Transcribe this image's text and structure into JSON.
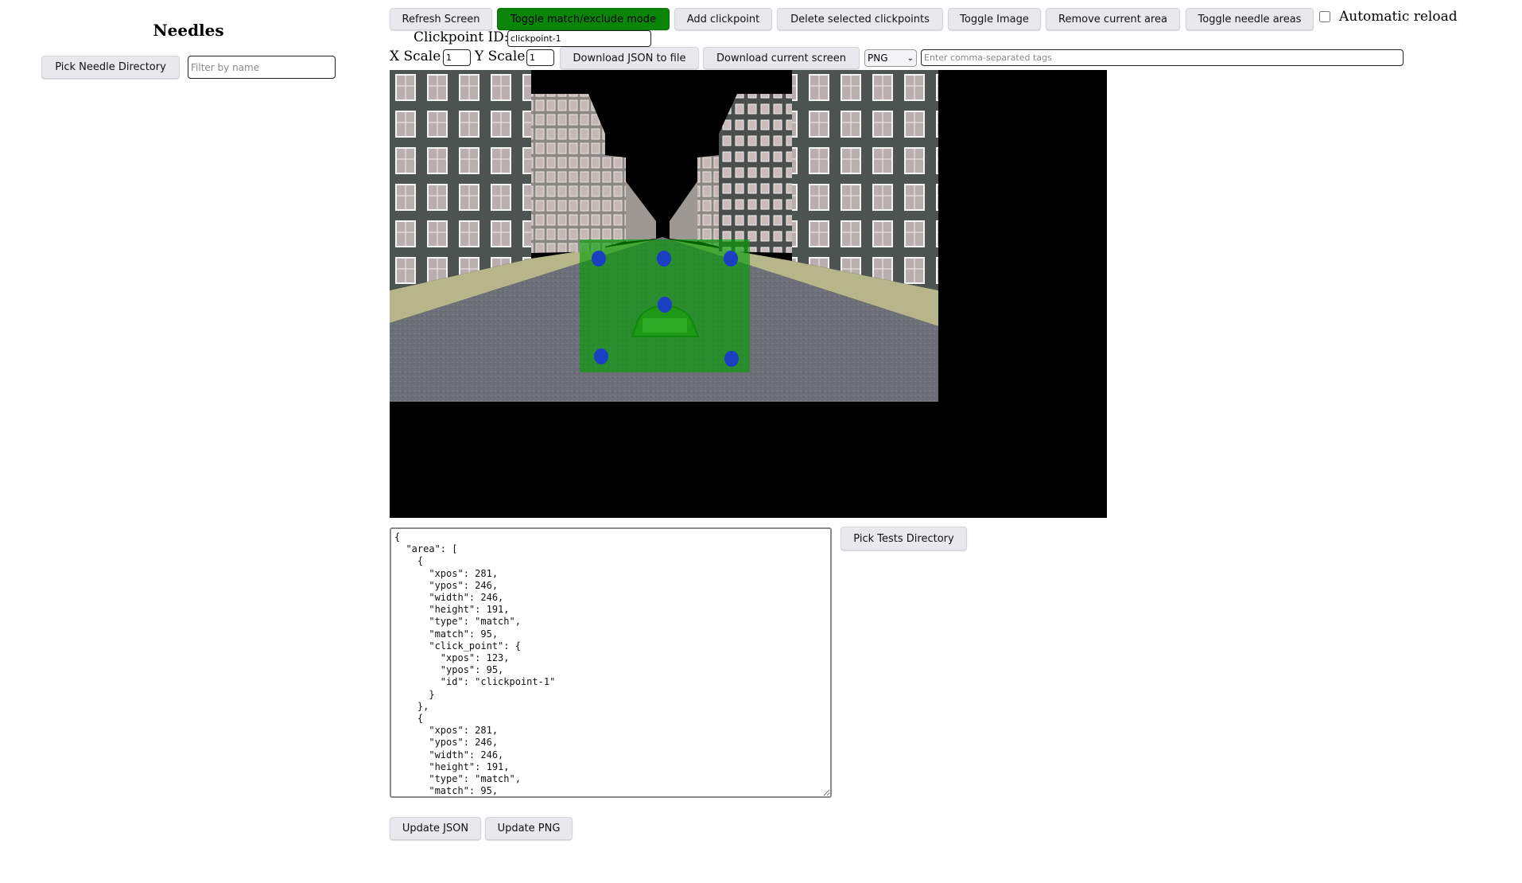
{
  "sidebar": {
    "title": "Needles",
    "pick_dir_label": "Pick Needle Directory",
    "filter_placeholder": "Filter by name"
  },
  "toolbar": {
    "buttons": [
      {
        "label": "Refresh Screen"
      },
      {
        "label": "Toggle match/exclude mode",
        "active": true,
        "color": "#0a850a"
      },
      {
        "label": "Add clickpoint"
      },
      {
        "label": "Delete selected clickpoints"
      },
      {
        "label": "Toggle Image"
      },
      {
        "label": "Remove current area"
      },
      {
        "label": "Toggle needle areas"
      }
    ],
    "auto_reload_label": "Automatic reload",
    "auto_reload_checked": false,
    "clickpoint_label": "Clickpoint ID:",
    "clickpoint_value": "clickpoint-1",
    "xscale_label": "X Scale",
    "xscale_value": "1",
    "yscale_label": "Y Scale",
    "yscale_value": "1",
    "download_json_label": "Download JSON to file",
    "download_screen_label": "Download current screen",
    "format_value": "PNG",
    "tags_placeholder": "Enter comma-separated tags"
  },
  "editor": {
    "json_text": "{\n  \"area\": [\n    {\n      \"xpos\": 281,\n      \"ypos\": 246,\n      \"width\": 246,\n      \"height\": 191,\n      \"type\": \"match\",\n      \"match\": 95,\n      \"click_point\": {\n        \"xpos\": 123,\n        \"ypos\": 95,\n        \"id\": \"clickpoint-1\"\n      }\n    },\n    {\n      \"xpos\": 281,\n      \"ypos\": 246,\n      \"width\": 246,\n      \"height\": 191,\n      \"type\": \"match\",\n      \"match\": 95,",
    "pick_tests_label": "Pick Tests Directory",
    "update_json_label": "Update JSON",
    "update_png_label": "Update PNG"
  },
  "screen": {
    "area_color": "#00a000",
    "handle_color": "#1a3fc0"
  }
}
